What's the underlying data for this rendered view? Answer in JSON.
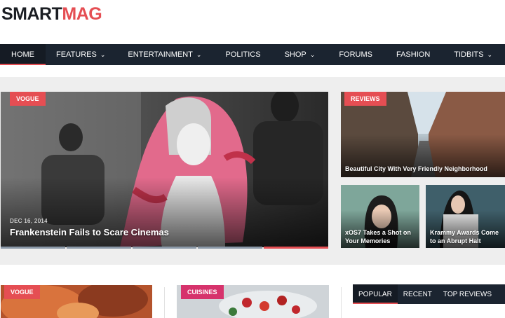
{
  "logo": {
    "part1": "SMART",
    "part2": "MAG"
  },
  "nav": [
    {
      "label": "HOME",
      "dropdown": false,
      "active": true
    },
    {
      "label": "FEATURES",
      "dropdown": true
    },
    {
      "label": "ENTERTAINMENT",
      "dropdown": true
    },
    {
      "label": "POLITICS",
      "dropdown": false
    },
    {
      "label": "SHOP",
      "dropdown": true
    },
    {
      "label": "FORUMS",
      "dropdown": false
    },
    {
      "label": "FASHION",
      "dropdown": false
    },
    {
      "label": "TIDBITS",
      "dropdown": true
    }
  ],
  "chevron": "⌄",
  "featured": {
    "main": {
      "badge": "VOGUE",
      "date": "DEC 16, 2014",
      "title": "Frankenstein Fails to Scare Cinemas"
    },
    "right_top": {
      "badge": "REVIEWS",
      "title": "Beautiful City With Very Friendly Neighborhood"
    },
    "right_bottom_left": {
      "title": "xOS7 Takes a Shot on Your Memories"
    },
    "right_bottom_right": {
      "title": "Krammy Awards Come to an Abrupt Halt"
    }
  },
  "slider": {
    "slides": 5,
    "active_index": 4
  },
  "bottom": {
    "card1": {
      "badge": "VOGUE"
    },
    "card2": {
      "badge": "CUISINES"
    },
    "tabs": [
      "POPULAR",
      "RECENT",
      "TOP REVIEWS"
    ]
  },
  "colors": {
    "accent": "#e54e53",
    "nav_bg": "#1b2430",
    "pink_badge": "#d6336c"
  }
}
